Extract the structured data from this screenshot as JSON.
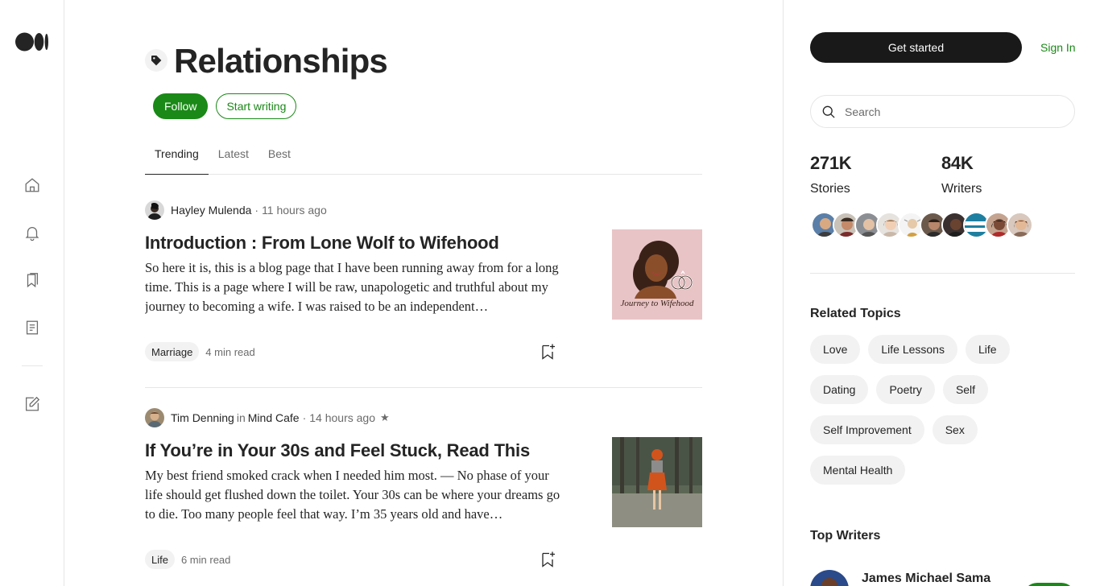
{
  "logo": {
    "icon": "medium-logo-icon"
  },
  "nav": {
    "items": [
      {
        "icon": "home-icon"
      },
      {
        "icon": "bell-icon"
      },
      {
        "icon": "bookmarks-icon"
      },
      {
        "icon": "stories-icon"
      },
      {
        "icon": "write-icon"
      }
    ]
  },
  "topic": {
    "title": "Relationships",
    "follow_label": "Follow",
    "start_writing_label": "Start writing"
  },
  "tabs": [
    {
      "label": "Trending",
      "active": true
    },
    {
      "label": "Latest",
      "active": false
    },
    {
      "label": "Best",
      "active": false
    }
  ],
  "posts": [
    {
      "author": "Hayley Mulenda",
      "publication": "",
      "time": "11 hours ago",
      "title": "Introduction : From Lone Wolf to Wifehood",
      "excerpt": "So here it is, this is a blog page that I have been running away from for a long time. This is a page where I will be raw, unapologetic and truthful about my journey to becoming a wife. I was raised to be an independent…",
      "tag": "Marriage",
      "read_time": "4 min read",
      "thumb_text": "Journey to Wifehood"
    },
    {
      "author": "Tim Denning",
      "in_word": "in",
      "publication": "Mind Cafe",
      "time": "14 hours ago",
      "star": "★",
      "title": "If You’re in Your 30s and Feel Stuck, Read This",
      "excerpt": "My best friend smoked crack when I needed him most. — No phase of your life should get flushed down the toilet. Your 30s can be where your dreams go to die. Too many people feel that way. I’m 35 years old and have…",
      "tag": "Life",
      "read_time": "6 min read"
    }
  ],
  "sidebar": {
    "get_started_label": "Get started",
    "sign_in_label": "Sign In",
    "search_placeholder": "Search",
    "stories_count": "271K",
    "stories_label": "Stories",
    "writers_count": "84K",
    "writers_label": "Writers",
    "related_topics_heading": "Related Topics",
    "related_topics": [
      "Love",
      "Life Lessons",
      "Life",
      "Dating",
      "Poetry",
      "Self",
      "Self Improvement",
      "Sex",
      "Mental Health"
    ],
    "top_writers_heading": "Top Writers",
    "top_writers": [
      {
        "name": "James Michael Sama"
      }
    ]
  },
  "colors": {
    "accent": "#1a8917",
    "text": "#242424",
    "muted": "#6b6b6b",
    "chip_bg": "#f2f2f2"
  }
}
